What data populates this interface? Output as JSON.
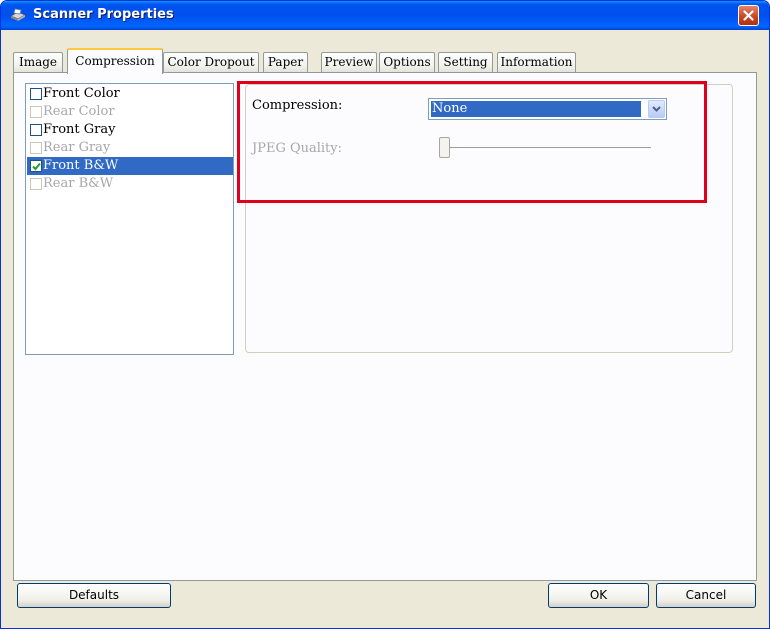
{
  "window": {
    "title": "Scanner Properties"
  },
  "tabs": [
    {
      "label": "Image"
    },
    {
      "label": "Compression"
    },
    {
      "label": "Color Dropout"
    },
    {
      "label": "Paper"
    },
    {
      "label": "Preview"
    },
    {
      "label": "Options"
    },
    {
      "label": "Setting"
    },
    {
      "label": "Information"
    }
  ],
  "active_tab": "Compression",
  "image_list": [
    {
      "label": "Front Color",
      "checked": false,
      "enabled": true
    },
    {
      "label": "Rear Color",
      "checked": false,
      "enabled": false
    },
    {
      "label": "Front Gray",
      "checked": false,
      "enabled": true
    },
    {
      "label": "Rear Gray",
      "checked": false,
      "enabled": false
    },
    {
      "label": "Front B&W",
      "checked": true,
      "enabled": true,
      "selected": true
    },
    {
      "label": "Rear B&W",
      "checked": false,
      "enabled": false
    }
  ],
  "compression": {
    "label": "Compression:",
    "value": "None"
  },
  "jpeg_quality": {
    "label": "JPEG Quality:",
    "enabled": false
  },
  "buttons": {
    "defaults": "Defaults",
    "ok": "OK",
    "cancel": "Cancel"
  },
  "colors": {
    "title_bar": "#0053ee",
    "selection": "#316ac5",
    "highlight_box": "#e0001b",
    "window_bg": "#ece9d8"
  }
}
